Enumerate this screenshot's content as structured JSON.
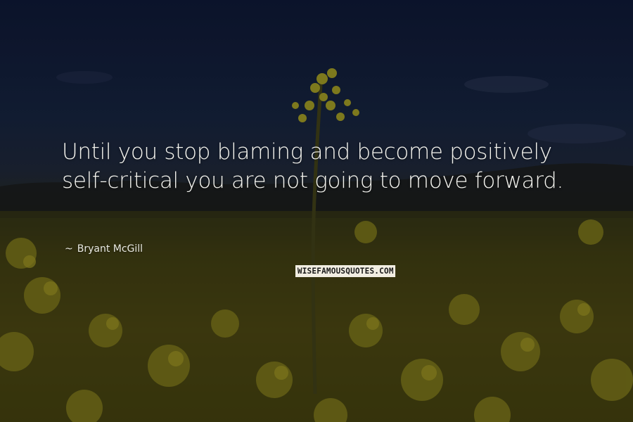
{
  "quote": {
    "text": "Until you stop blaming and become positively self-critical you are not going to move forward.",
    "dash": "~",
    "author": "Bryant McGill"
  },
  "watermark": {
    "text": "WISEFAMOUSQUOTES.COM"
  },
  "colors": {
    "sky": "#0f1830",
    "field": "#4a4510",
    "flowers": "#8c8420",
    "text": "#f4f4ef"
  }
}
